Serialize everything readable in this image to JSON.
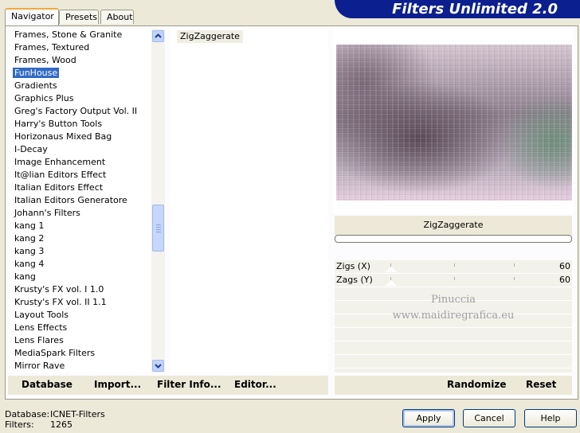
{
  "app": {
    "title": "Filters Unlimited 2.0"
  },
  "tabs": [
    {
      "label": "Navigator",
      "active": true
    },
    {
      "label": "Presets",
      "active": false
    },
    {
      "label": "About",
      "active": false
    }
  ],
  "categories": [
    "Frames, Stone & Granite",
    "Frames, Textured",
    "Frames, Wood",
    "FunHouse",
    "Gradients",
    "Graphics Plus",
    "Greg's Factory Output Vol. II",
    "Harry's Button Tools",
    "Horizonaus Mixed Bag",
    "I-Decay",
    "Image Enhancement",
    "It@lian Editors Effect",
    "Italian Editors Effect",
    "Italian Editors Generatore",
    "Johann's Filters",
    "kang 1",
    "kang 2",
    "kang 3",
    "kang 4",
    "kang",
    "Krusty's FX vol. I 1.0",
    "Krusty's FX vol. II 1.1",
    "Layout Tools",
    "Lens Effects",
    "Lens Flares",
    "MediaSpark Filters",
    "Mirror Rave"
  ],
  "selected_category": "FunHouse",
  "filters": [
    "ZigZaggerate"
  ],
  "preview": {
    "filter_name": "ZigZaggerate"
  },
  "params": [
    {
      "name": "Zigs (X)",
      "value": "60"
    },
    {
      "name": "Zags (Y)",
      "value": "60"
    }
  ],
  "watermark": {
    "line1": "Pinuccia",
    "line2": "www.maidiregrafica.eu"
  },
  "actions_left": [
    "Database",
    "Import...",
    "Filter Info...",
    "Editor..."
  ],
  "actions_right": [
    "Randomize",
    "Reset"
  ],
  "footer": {
    "database_label": "Database:",
    "database_value": "ICNET-Filters",
    "filters_label": "Filters:",
    "filters_value": "1265"
  },
  "buttons": {
    "apply": "Apply",
    "cancel": "Cancel",
    "help": "Help"
  },
  "colors": {
    "banner": "#0b1f8e",
    "selection": "#316ac5",
    "tab_accent": "#f2a93b"
  }
}
